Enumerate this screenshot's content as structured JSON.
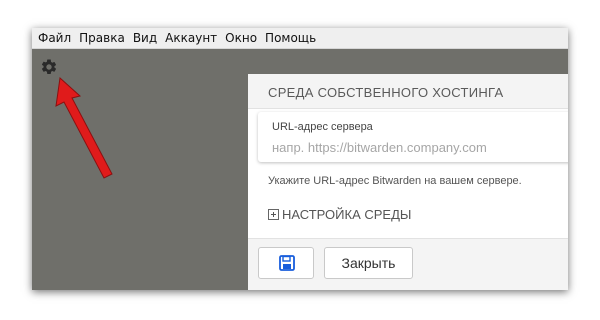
{
  "menubar": {
    "items": [
      {
        "label": "Файл"
      },
      {
        "label": "Правка"
      },
      {
        "label": "Вид"
      },
      {
        "label": "Аккаунт"
      },
      {
        "label": "Окно"
      },
      {
        "label": "Помощь"
      }
    ]
  },
  "toolbar": {
    "settings_icon": "gear-icon"
  },
  "annotation": {
    "arrow_color": "#e01b1b"
  },
  "panel": {
    "title": "СРЕДА СОБСТВЕННОГО ХОСТИНГА",
    "server_url": {
      "label": "URL-адрес сервера",
      "value": "",
      "placeholder": "напр. https://bitwarden.company.com"
    },
    "help_text": "Укажите URL-адрес Bitwarden на вашем сервере.",
    "environment_settings_label": "НАСТРОЙКА СРЕДЫ",
    "save_icon": "save-icon",
    "close_label": "Закрыть"
  },
  "colors": {
    "background": "#6f6f6a",
    "accent": "#175ddc"
  }
}
